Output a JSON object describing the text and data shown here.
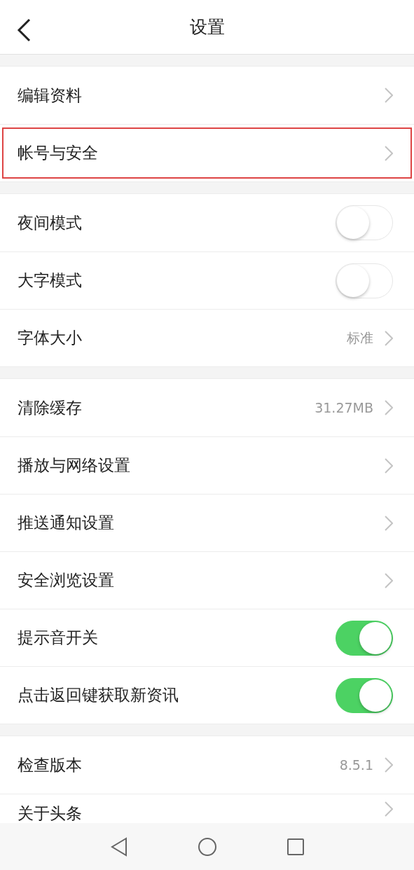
{
  "header": {
    "title": "设置"
  },
  "groups": [
    {
      "rows": [
        {
          "kind": "link",
          "label": "编辑资料",
          "highlighted": false
        },
        {
          "kind": "link",
          "label": "帐号与安全",
          "highlighted": true
        }
      ]
    },
    {
      "rows": [
        {
          "kind": "toggle",
          "label": "夜间模式",
          "on": false
        },
        {
          "kind": "toggle",
          "label": "大字模式",
          "on": false
        },
        {
          "kind": "link",
          "label": "字体大小",
          "value": "标准",
          "highlighted": false
        }
      ]
    },
    {
      "rows": [
        {
          "kind": "link",
          "label": "清除缓存",
          "value": "31.27MB",
          "highlighted": false
        },
        {
          "kind": "link",
          "label": "播放与网络设置",
          "highlighted": false
        },
        {
          "kind": "link",
          "label": "推送通知设置",
          "highlighted": false
        },
        {
          "kind": "link",
          "label": "安全浏览设置",
          "highlighted": false
        },
        {
          "kind": "toggle",
          "label": "提示音开关",
          "on": true
        },
        {
          "kind": "toggle",
          "label": "点击返回键获取新资讯",
          "on": true
        }
      ]
    },
    {
      "rows": [
        {
          "kind": "link",
          "label": "检查版本",
          "value": "8.5.1",
          "highlighted": false
        },
        {
          "kind": "link",
          "label": "关于头条",
          "highlighted": false,
          "cut": true
        }
      ]
    }
  ]
}
